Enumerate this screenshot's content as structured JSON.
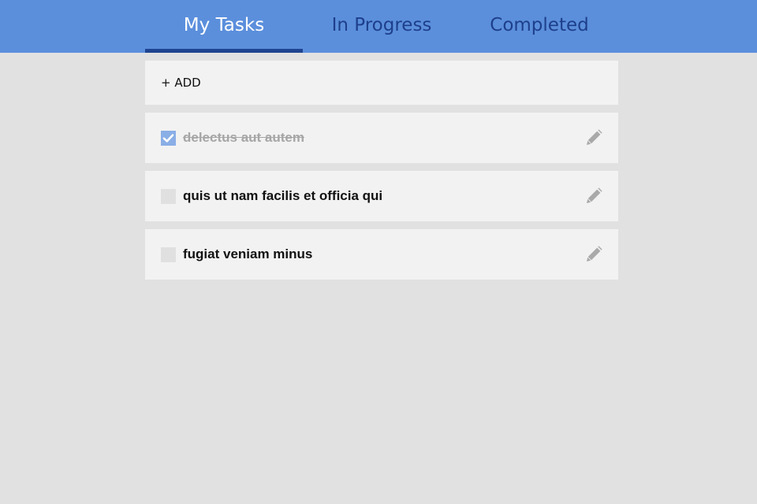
{
  "header": {
    "tabs": [
      {
        "label": "My Tasks",
        "active": true
      },
      {
        "label": "In Progress",
        "active": false
      },
      {
        "label": "Completed",
        "active": false
      }
    ]
  },
  "main": {
    "add_label": "+ ADD",
    "tasks": [
      {
        "label": "delectus aut autem",
        "checked": true,
        "edit_icon": "pencil-icon"
      },
      {
        "label": "quis ut nam facilis et officia qui",
        "checked": false,
        "edit_icon": "pencil-icon"
      },
      {
        "label": "fugiat veniam minus",
        "checked": false,
        "edit_icon": "pencil-icon"
      }
    ]
  },
  "colors": {
    "header_bg": "#5b8fdc",
    "active_tab_text": "#ffffff",
    "inactive_tab_text": "#1e3f8a",
    "active_indicator": "#1f4490",
    "page_bg": "#e1e1e1",
    "row_bg": "#f2f2f2",
    "checked_box": "#8aaee6",
    "completed_text": "#a6a6a6"
  }
}
